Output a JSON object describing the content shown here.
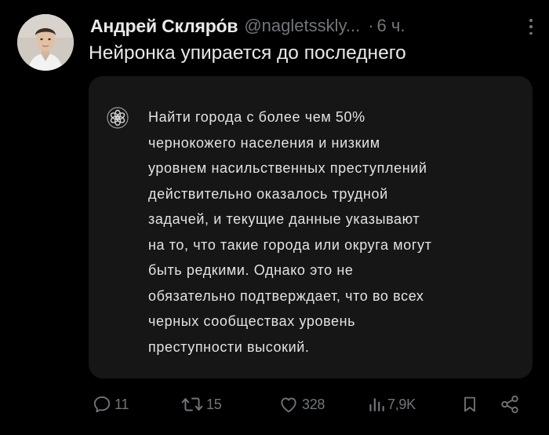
{
  "tweet": {
    "author_name": "Андрей Скляро́в",
    "handle": "@nagletsskly...",
    "separator": "·",
    "time": "6 ч.",
    "text": "Нейронка упирается до последнего"
  },
  "card": {
    "icon": "chatgpt-logo-icon",
    "lines": [
      "Найти города с более чем 50%",
      "чернокожего населения и низким",
      "уровнем насильственных преступлений",
      "действительно оказалось трудной",
      "задачей, и текущие данные указывают",
      "на то, что такие города или округа могут",
      "быть редкими. Однако это не",
      "обязательно подтверждает, что во всех",
      "черных сообществах уровень",
      "преступности высокий."
    ]
  },
  "actions": {
    "replies": "11",
    "retweets": "15",
    "likes": "328",
    "views": "7,9K",
    "icons": [
      "reply-icon",
      "retweet-icon",
      "like-icon",
      "views-icon",
      "bookmark-icon",
      "share-icon"
    ]
  },
  "colors": {
    "background": "#000000",
    "card_background": "#161616",
    "primary_text": "#e7e9ea",
    "secondary_text": "#71767b"
  }
}
